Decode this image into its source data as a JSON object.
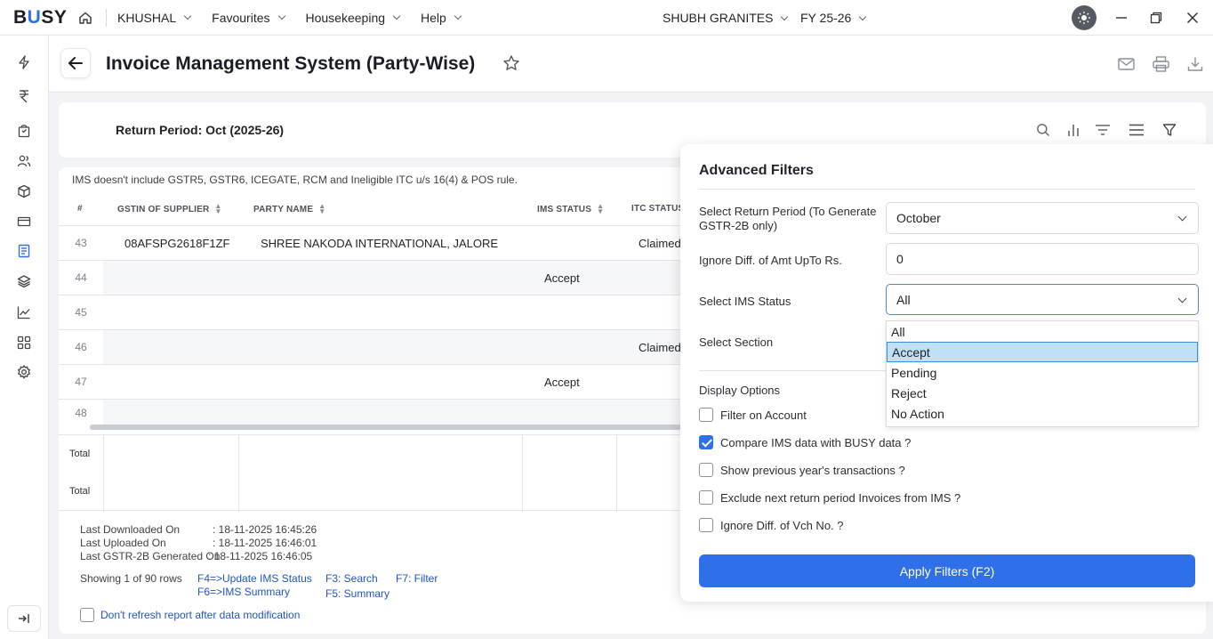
{
  "topbar": {
    "logo_pre": "B",
    "logo_mid": "U",
    "logo_post": "SY",
    "menus": [
      "KHUSHAL",
      "Favourites",
      "Housekeeping",
      "Help"
    ],
    "company": "SHUBH GRANITES",
    "fy": "FY 25-26"
  },
  "header": {
    "title": "Invoice Management System (Party-Wise)"
  },
  "report": {
    "return_period": "Return Period: Oct (2025-26)",
    "note": "IMS doesn't include GSTR5, GSTR6, ICEGATE, RCM and Ineligible ITC u/s 16(4) & POS rule.",
    "columns": [
      "#",
      "GSTIN OF SUPPLIER",
      "PARTY NAME",
      "IMS STATUS",
      "ITC STATUS"
    ],
    "rows": [
      {
        "num": "43",
        "gstin": "08AFSPG2618F1ZF",
        "party": "SHREE NAKODA INTERNATIONAL, JALORE",
        "ims": "",
        "itc": "Claimed"
      },
      {
        "num": "44",
        "gstin": "",
        "party": "",
        "ims": "Accept",
        "itc": ""
      },
      {
        "num": "45",
        "gstin": "",
        "party": "",
        "ims": "",
        "itc": ""
      },
      {
        "num": "46",
        "gstin": "",
        "party": "",
        "ims": "",
        "itc": "Claimed"
      },
      {
        "num": "47",
        "gstin": "",
        "party": "",
        "ims": "Accept",
        "itc": ""
      },
      {
        "num": "48",
        "gstin": "",
        "party": "",
        "ims": "",
        "itc": ""
      }
    ],
    "total_label": "Total",
    "last_downloaded_label": "Last Downloaded On",
    "last_downloaded": ":  18-11-2025 16:45:26",
    "last_uploaded_label": "Last Uploaded On",
    "last_uploaded": ":  18-11-2025 16:46:01",
    "last_gstr_label": "Last GSTR-2B Generated On",
    "last_gstr": ":  18-11-2025 16:46:05",
    "showing": "Showing 1 of 90 rows",
    "shortcuts": {
      "f4": "F4=>Update IMS Status",
      "f6": "F6=>IMS Summary",
      "f3": "F3: Search",
      "f5": "F5: Summary",
      "f7": "F7: Filter"
    },
    "dont_refresh": "Don't refresh report after data modification"
  },
  "filters": {
    "title": "Advanced Filters",
    "return_period_label": "Select Return Period (To Generate GSTR-2B only)",
    "return_period_value": "October",
    "ignore_diff_label": "Ignore Diff. of Amt UpTo Rs.",
    "ignore_diff_value": "0",
    "ims_status_label": "Select IMS Status",
    "ims_status_value": "All",
    "ims_status_options": [
      "All",
      "Accept",
      "Pending",
      "Reject",
      "No Action"
    ],
    "section_label": "Select Section",
    "display_options_label": "Display Options",
    "options": [
      {
        "label": "Filter on Account",
        "checked": false
      },
      {
        "label": "Compare IMS data with BUSY data ?",
        "checked": true
      },
      {
        "label": "Show previous year's transactions ?",
        "checked": false
      },
      {
        "label": "Exclude next return period Invoices from IMS ?",
        "checked": false
      },
      {
        "label": "Ignore Diff. of Vch No. ?",
        "checked": false
      }
    ],
    "apply_label": "Apply Filters (F2)"
  },
  "colors": {
    "accent": "#2f6fe8",
    "selected_option": "#bfe0f5",
    "link": "#1f55c5"
  }
}
